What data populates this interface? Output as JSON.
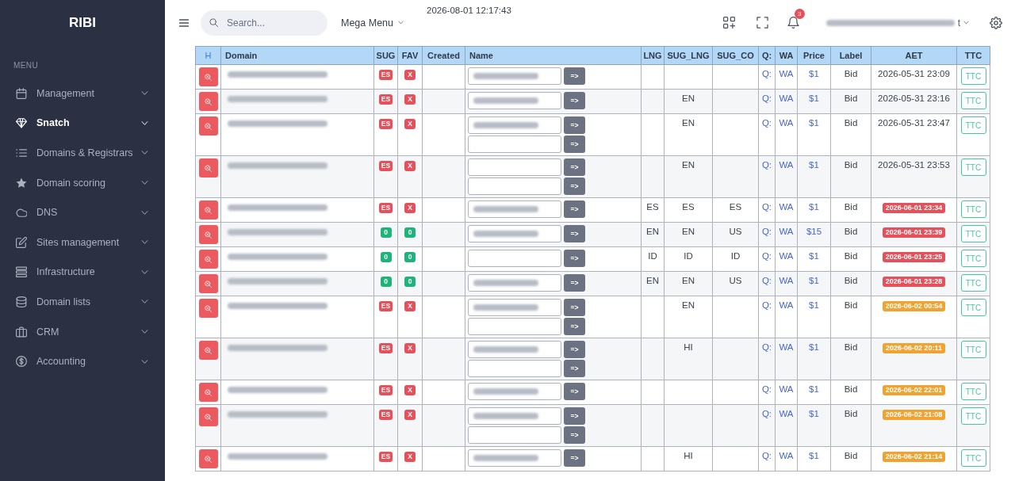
{
  "sidebar": {
    "logo": "RIBI",
    "section_title": "MENU",
    "items": [
      {
        "label": "Management",
        "selected": false
      },
      {
        "label": "Snatch",
        "selected": true
      },
      {
        "label": "Domains & Registrars",
        "selected": false
      },
      {
        "label": "Domain scoring",
        "selected": false
      },
      {
        "label": "DNS",
        "selected": false
      },
      {
        "label": "Sites management",
        "selected": false
      },
      {
        "label": "Infrastructure",
        "selected": false
      },
      {
        "label": "Domain lists",
        "selected": false
      },
      {
        "label": "CRM",
        "selected": false
      },
      {
        "label": "Accounting",
        "selected": false
      }
    ]
  },
  "topbar": {
    "search": {
      "placeholder": "Search..."
    },
    "mega_menu": "Mega Menu",
    "datetime": "2026-08-01 12:17:43",
    "notification_count": "3",
    "user": {
      "blurred": true,
      "trailing_text": "t"
    }
  },
  "table": {
    "columns": [
      "H",
      "Domain",
      "SUG",
      "FAV",
      "Created",
      "Name",
      "LNG",
      "SUG_LNG",
      "SUG_CO",
      "Q:",
      "WA",
      "Price",
      "Label",
      "AET",
      "TTC"
    ],
    "rows": [
      {
        "domain_blurred": true,
        "sug": {
          "text": "ES",
          "color": "#e5505a"
        },
        "fav": {
          "text": "X",
          "color": "#e5505a"
        },
        "names": [
          {
            "blurred": true,
            "button": "=>"
          }
        ],
        "q": "Q:",
        "wa": "WA",
        "price": "$1",
        "label": "Bid",
        "aet": {
          "text": "2026-05-31 23:09"
        },
        "ttc": "TTC"
      },
      {
        "domain_blurred": true,
        "sug": {
          "text": "ES",
          "color": "#e5505a"
        },
        "fav": {
          "text": "X",
          "color": "#e5505a"
        },
        "names": [
          {
            "blurred": true,
            "button": "=>"
          }
        ],
        "sug_lng": "EN",
        "q": "Q:",
        "wa": "WA",
        "price": "$1",
        "label": "Bid",
        "aet": {
          "text": "2026-05-31 23:16"
        },
        "ttc": "TTC"
      },
      {
        "domain_blurred": true,
        "sug": {
          "text": "ES",
          "color": "#e5505a"
        },
        "fav": {
          "text": "X",
          "color": "#e5505a"
        },
        "names": [
          {
            "blurred": true,
            "button": "=>"
          },
          {
            "blurred": false,
            "button": "=>"
          }
        ],
        "sug_lng": "EN",
        "q": "Q:",
        "wa": "WA",
        "price": "$1",
        "label": "Bid",
        "aet": {
          "text": "2026-05-31 23:47"
        },
        "ttc": "TTC"
      },
      {
        "domain_blurred": true,
        "sug": {
          "text": "ES",
          "color": "#e5505a"
        },
        "fav": {
          "text": "X",
          "color": "#e5505a"
        },
        "names": [
          {
            "blurred": false,
            "button": "=>"
          },
          {
            "blurred": false,
            "button": "=>"
          }
        ],
        "sug_lng": "EN",
        "q": "Q:",
        "wa": "WA",
        "price": "$1",
        "label": "Bid",
        "aet": {
          "text": "2026-05-31 23:53"
        },
        "ttc": "TTC"
      },
      {
        "domain_blurred": true,
        "sug": {
          "text": "ES",
          "color": "#e5505a"
        },
        "fav": {
          "text": "X",
          "color": "#e5505a"
        },
        "names": [
          {
            "blurred": true,
            "button": "=>"
          }
        ],
        "lng": "ES",
        "sug_lng": "ES",
        "sug_co": "ES",
        "q": "Q:",
        "wa": "WA",
        "price": "$1",
        "label": "Bid",
        "aet": {
          "text": "2026-06-01 23:34",
          "color": "#e5505a"
        },
        "ttc": "TTC"
      },
      {
        "domain_blurred": true,
        "sug": {
          "text": "0",
          "color": "#1fb37c"
        },
        "fav": {
          "text": "0",
          "color": "#1fb37c"
        },
        "names": [
          {
            "blurred": true,
            "button": "=>"
          }
        ],
        "lng": "EN",
        "sug_lng": "EN",
        "sug_co": "US",
        "q": "Q:",
        "wa": "WA",
        "price": "$15",
        "label": "Bid",
        "aet": {
          "text": "2026-06-01 23:39",
          "color": "#e5505a"
        },
        "ttc": "TTC"
      },
      {
        "domain_blurred": true,
        "sug": {
          "text": "0",
          "color": "#1fb37c"
        },
        "fav": {
          "text": "0",
          "color": "#1fb37c"
        },
        "names": [
          {
            "blurred": false,
            "button": "=>"
          }
        ],
        "lng": "ID",
        "sug_lng": "ID",
        "sug_co": "ID",
        "q": "Q:",
        "wa": "WA",
        "price": "$1",
        "label": "Bid",
        "aet": {
          "text": "2026-06-01 23:25",
          "color": "#e5505a"
        },
        "ttc": "TTC"
      },
      {
        "domain_blurred": true,
        "sug": {
          "text": "0",
          "color": "#1fb37c"
        },
        "fav": {
          "text": "0",
          "color": "#1fb37c"
        },
        "names": [
          {
            "blurred": true,
            "button": "=>"
          }
        ],
        "lng": "EN",
        "sug_lng": "EN",
        "sug_co": "US",
        "q": "Q:",
        "wa": "WA",
        "price": "$1",
        "label": "Bid",
        "aet": {
          "text": "2026-06-01 23:28",
          "color": "#e5505a"
        },
        "ttc": "TTC"
      },
      {
        "domain_blurred": true,
        "sug": {
          "text": "ES",
          "color": "#e5505a"
        },
        "fav": {
          "text": "X",
          "color": "#e5505a"
        },
        "names": [
          {
            "blurred": true,
            "button": "=>"
          },
          {
            "blurred": false,
            "button": "=>"
          }
        ],
        "sug_lng": "EN",
        "q": "Q:",
        "wa": "WA",
        "price": "$1",
        "label": "Bid",
        "aet": {
          "text": "2026-06-02 00:54",
          "color": "#f0a330"
        },
        "ttc": "TTC"
      },
      {
        "domain_blurred": true,
        "sug": {
          "text": "ES",
          "color": "#e5505a"
        },
        "fav": {
          "text": "X",
          "color": "#e5505a"
        },
        "names": [
          {
            "blurred": true,
            "button": "=>"
          },
          {
            "blurred": false,
            "button": "=>"
          }
        ],
        "sug_lng": "HI",
        "q": "Q:",
        "wa": "WA",
        "price": "$1",
        "label": "Bid",
        "aet": {
          "text": "2026-06-02 20:11",
          "color": "#f0a330"
        },
        "ttc": "TTC"
      },
      {
        "domain_blurred": true,
        "sug": {
          "text": "ES",
          "color": "#e5505a"
        },
        "fav": {
          "text": "X",
          "color": "#e5505a"
        },
        "names": [
          {
            "blurred": true,
            "button": "=>"
          }
        ],
        "q": "Q:",
        "wa": "WA",
        "price": "$1",
        "label": "Bid",
        "aet": {
          "text": "2026-06-02 22:01",
          "color": "#f0a330"
        },
        "ttc": "TTC"
      },
      {
        "domain_blurred": true,
        "sug": {
          "text": "ES",
          "color": "#e5505a"
        },
        "fav": {
          "text": "X",
          "color": "#e5505a"
        },
        "names": [
          {
            "blurred": true,
            "button": "=>"
          },
          {
            "blurred": false,
            "button": "=>"
          }
        ],
        "q": "Q:",
        "wa": "WA",
        "price": "$1",
        "label": "Bid",
        "aet": {
          "text": "2026-06-02 21:08",
          "color": "#f0a330"
        },
        "ttc": "TTC"
      },
      {
        "domain_blurred": true,
        "sug": {
          "text": "ES",
          "color": "#e5505a"
        },
        "fav": {
          "text": "X",
          "color": "#e5505a"
        },
        "names": [
          {
            "blurred": true,
            "button": "=>"
          }
        ],
        "sug_lng": "HI",
        "q": "Q:",
        "wa": "WA",
        "price": "$1",
        "label": "Bid",
        "aet": {
          "text": "2026-06-02 21:14",
          "color": "#f0a330"
        },
        "ttc": "TTC"
      }
    ]
  }
}
